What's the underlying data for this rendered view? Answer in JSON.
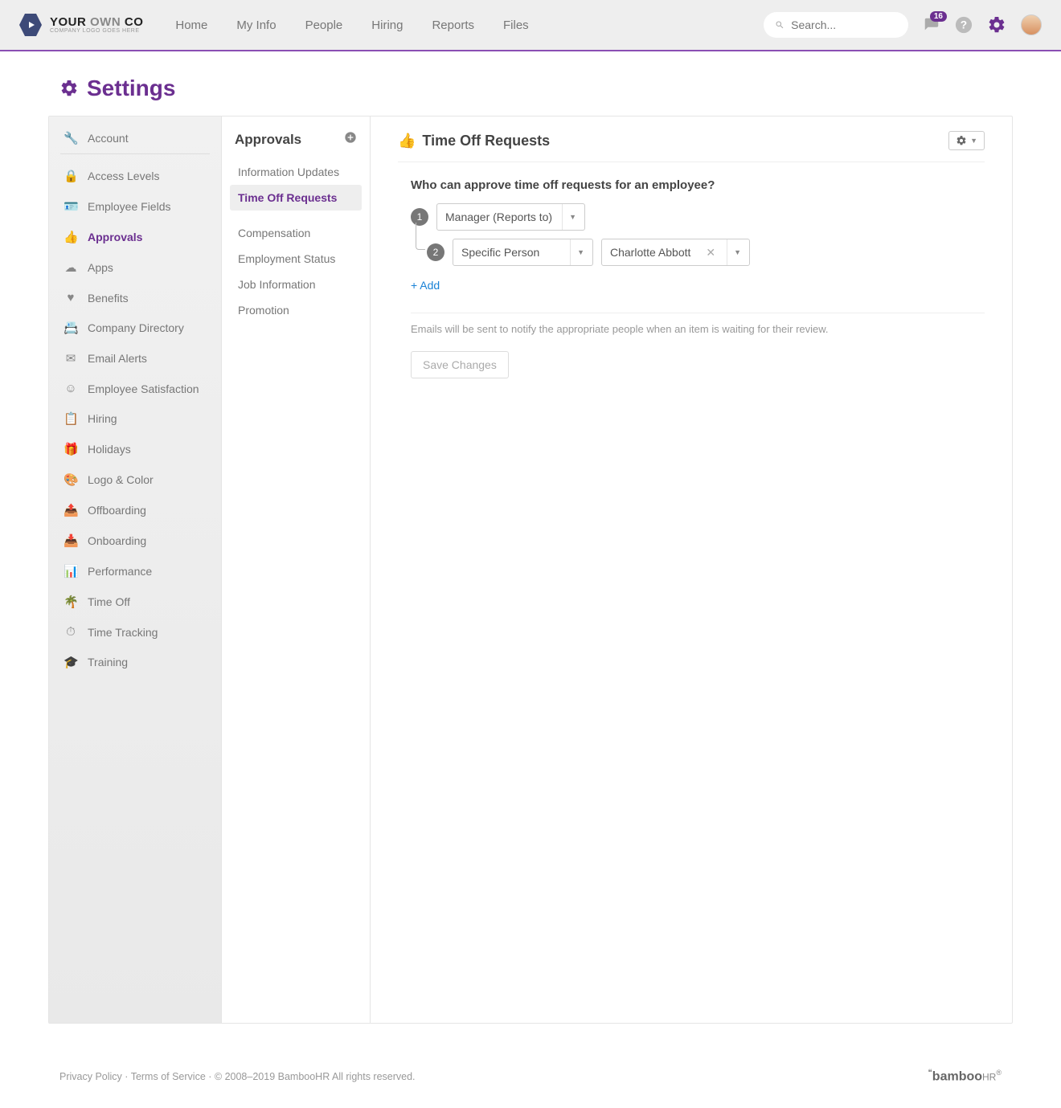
{
  "header": {
    "logo_line1_a": "YOUR ",
    "logo_line1_b": "OWN",
    "logo_line1_c": " CO",
    "logo_line2": "COMPANY LOGO GOES HERE",
    "nav": [
      "Home",
      "My Info",
      "People",
      "Hiring",
      "Reports",
      "Files"
    ],
    "search_placeholder": "Search...",
    "notif_count": "16"
  },
  "page_title": "Settings",
  "sidebar": {
    "account": "Account",
    "items": [
      "Access Levels",
      "Employee Fields",
      "Approvals",
      "Apps",
      "Benefits",
      "Company Directory",
      "Email Alerts",
      "Employee Satisfaction",
      "Hiring",
      "Holidays",
      "Logo & Color",
      "Offboarding",
      "Onboarding",
      "Performance",
      "Time Off",
      "Time Tracking",
      "Training"
    ]
  },
  "subnav": {
    "title": "Approvals",
    "items_a": [
      "Information Updates",
      "Time Off Requests"
    ],
    "items_b": [
      "Compensation",
      "Employment Status",
      "Job Information",
      "Promotion"
    ]
  },
  "main": {
    "title": "Time Off Requests",
    "question": "Who can approve time off requests for an employee?",
    "level1_num": "1",
    "level1_label": "Manager (Reports to)",
    "level2_num": "2",
    "level2_label": "Specific Person",
    "level2_person": "Charlotte Abbott",
    "add_label": "+ Add",
    "note": "Emails will be sent to notify the appropriate people when an item is waiting for their review.",
    "save_label": "Save Changes"
  },
  "footer": {
    "privacy": "Privacy Policy",
    "terms": "Terms of Service",
    "copyright": "© 2008–2019 BambooHR All rights reserved.",
    "sep": " · ",
    "brand_a": "bamboo",
    "brand_b": "HR",
    "brand_sup": "®"
  }
}
